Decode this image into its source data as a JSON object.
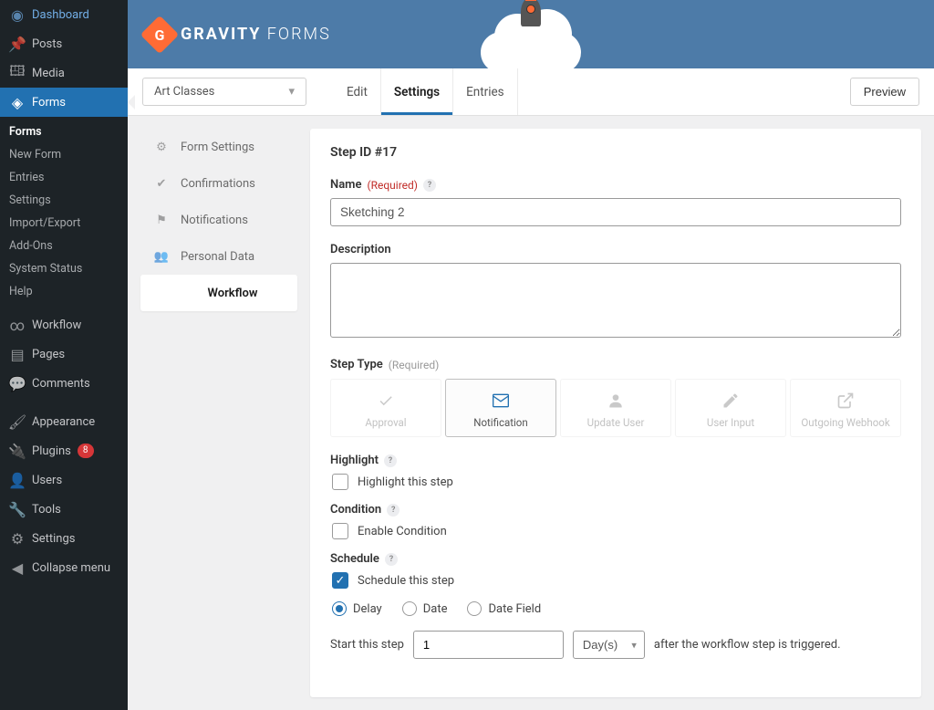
{
  "wp_menu": {
    "dashboard": "Dashboard",
    "posts": "Posts",
    "media": "Media",
    "forms": "Forms",
    "forms_sub": {
      "forms": "Forms",
      "new_form": "New Form",
      "entries": "Entries",
      "settings": "Settings",
      "import_export": "Import/Export",
      "addons": "Add-Ons",
      "system_status": "System Status",
      "help": "Help"
    },
    "workflow": "Workflow",
    "pages": "Pages",
    "comments": "Comments",
    "appearance": "Appearance",
    "plugins": "Plugins",
    "plugins_badge": "8",
    "users": "Users",
    "tools": "Tools",
    "settings": "Settings",
    "collapse": "Collapse menu"
  },
  "header": {
    "brand_bold": "GRAVITY",
    "brand_light": "FORMS"
  },
  "toolbar": {
    "form_name": "Art Classes",
    "tabs": {
      "edit": "Edit",
      "settings": "Settings",
      "entries": "Entries"
    },
    "preview": "Preview"
  },
  "sub_nav": {
    "form_settings": "Form Settings",
    "confirmations": "Confirmations",
    "notifications": "Notifications",
    "personal_data": "Personal Data",
    "workflow": "Workflow"
  },
  "panel": {
    "title": "Step ID #17",
    "name_label": "Name",
    "required": "(Required)",
    "name_value": "Sketching 2",
    "description_label": "Description",
    "description_value": "",
    "step_type_label": "Step Type",
    "step_types": {
      "approval": "Approval",
      "notification": "Notification",
      "update_user": "Update User",
      "user_input": "User Input",
      "outgoing_webhook": "Outgoing Webhook"
    },
    "highlight": {
      "label": "Highlight",
      "checkbox": "Highlight this step"
    },
    "condition": {
      "label": "Condition",
      "checkbox": "Enable Condition"
    },
    "schedule": {
      "label": "Schedule",
      "checkbox": "Schedule this step",
      "delay": "Delay",
      "date": "Date",
      "date_field": "Date Field",
      "start_text": "Start this step",
      "start_value": "1",
      "unit": "Day(s)",
      "after_text": "after the workflow step is triggered."
    }
  }
}
